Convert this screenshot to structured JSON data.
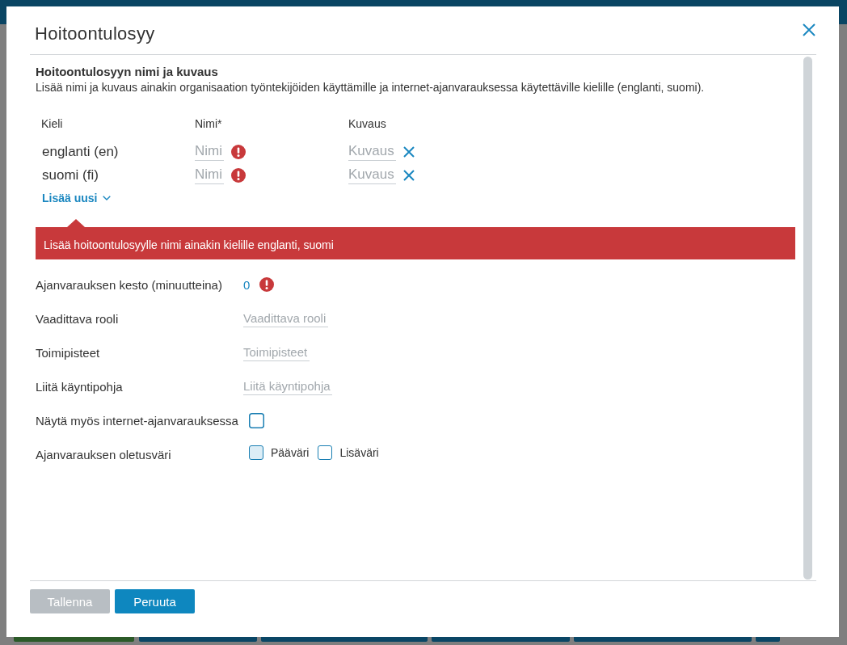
{
  "dialog": {
    "title": "Hoitoontulosyy"
  },
  "names_section": {
    "heading": "Hoitoontulosyyn nimi ja kuvaus",
    "description": "Lisää nimi ja kuvaus ainakin organisaation työntekijöiden käyttämille ja internet-ajanvarauksessa käytettäville kielille (englanti, suomi).",
    "columns": [
      "Kieli",
      "Nimi*",
      "Kuvaus"
    ],
    "rows": [
      {
        "language": "englanti (en)",
        "name": {
          "placeholder": "Nimi",
          "error": true
        },
        "description": {
          "placeholder": "Kuvaus"
        }
      },
      {
        "language": "suomi (fi)",
        "name": {
          "placeholder": "Nimi",
          "error": true
        },
        "description": {
          "placeholder": "Kuvaus"
        }
      }
    ],
    "add_link": "Lisää uusi",
    "error_message": "Lisää hoitoontulosyylle nimi ainakin kielille englanti, suomi"
  },
  "fields": [
    {
      "kind": "number",
      "label": "Ajanvarauksen kesto (minuutteina)",
      "value": "0",
      "error": true
    },
    {
      "kind": "text",
      "label": "Vaadittava rooli",
      "placeholder": "Vaadittava rooli"
    },
    {
      "kind": "text",
      "label": "Toimipisteet",
      "placeholder": "Toimipisteet"
    },
    {
      "kind": "text",
      "label": "Liitä käyntipohja",
      "placeholder": "Liitä käyntipohja"
    },
    {
      "kind": "checkbox",
      "label": "Näytä myös internet-ajanvarauksessa",
      "checked": false
    },
    {
      "kind": "colors",
      "label": "Ajanvarauksen oletusväri",
      "options": [
        {
          "label": "Pääväri",
          "color": "#dcedf6"
        },
        {
          "label": "Lisäväri",
          "color": "#ffffff"
        }
      ]
    }
  ],
  "buttons": [
    {
      "label": "Tallenna",
      "disabled": true
    },
    {
      "label": "Peruuta",
      "disabled": false
    }
  ]
}
